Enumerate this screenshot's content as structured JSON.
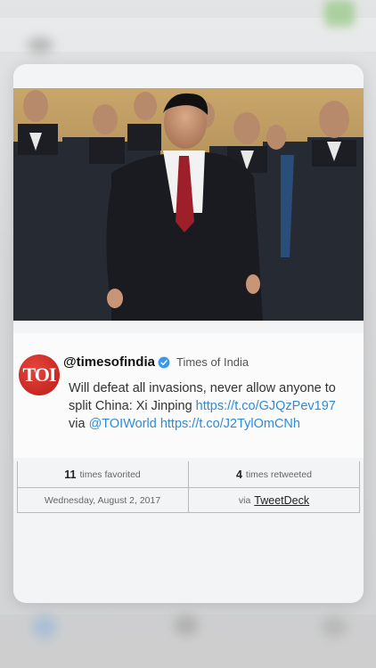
{
  "tweet": {
    "avatar_text": "TOI",
    "handle": "@timesofindia",
    "display_name": "Times of India",
    "text_main": "Will defeat all invasions, never allow anyone to split China: Xi Jinping",
    "link1": "https://t.co/GJQzPev197",
    "via_text": "via",
    "mention": "@TOIWorld",
    "link2": "https://t.co/J2TylOmCNh"
  },
  "stats": {
    "favorites_count": "11",
    "favorites_label": "times favorited",
    "retweets_count": "4",
    "retweets_label": "times retweeted",
    "date": "Wednesday, August 2, 2017",
    "source_prefix": "via",
    "source": "TweetDeck"
  },
  "colors": {
    "link": "#2f8bd8",
    "verified": "#3897f0",
    "avatar": "#d2261f"
  }
}
